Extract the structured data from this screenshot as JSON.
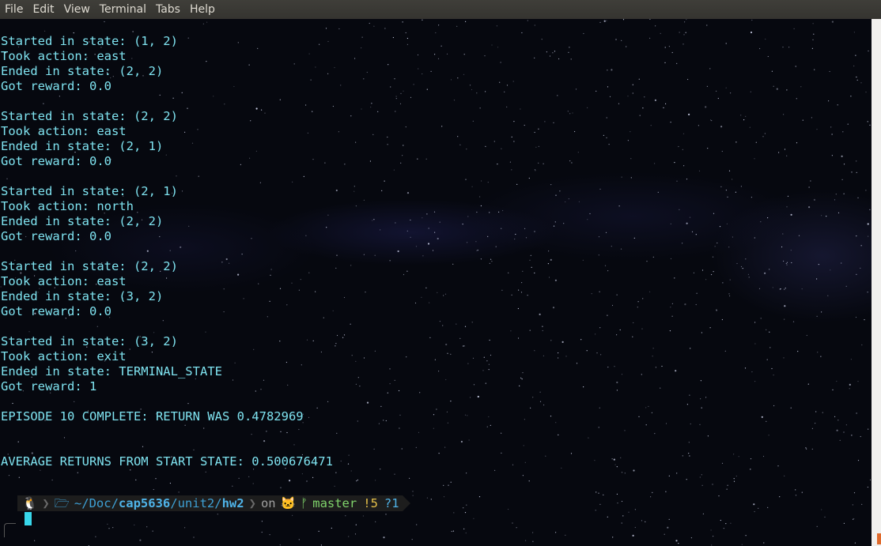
{
  "menubar": {
    "items": [
      "File",
      "Edit",
      "View",
      "Terminal",
      "Tabs",
      "Help"
    ]
  },
  "terminal": {
    "lines": [
      "Started in state: (1, 2)",
      "Took action: east",
      "Ended in state: (2, 2)",
      "Got reward: 0.0",
      "",
      "Started in state: (2, 2)",
      "Took action: east",
      "Ended in state: (2, 1)",
      "Got reward: 0.0",
      "",
      "Started in state: (2, 1)",
      "Took action: north",
      "Ended in state: (2, 2)",
      "Got reward: 0.0",
      "",
      "Started in state: (2, 2)",
      "Took action: east",
      "Ended in state: (3, 2)",
      "Got reward: 0.0",
      "",
      "Started in state: (3, 2)",
      "Took action: exit",
      "Ended in state: TERMINAL_STATE",
      "Got reward: 1",
      "",
      "EPISODE 10 COMPLETE: RETURN WAS 0.4782969",
      "",
      "",
      "AVERAGE RETURNS FROM START STATE: 0.500676471"
    ]
  },
  "prompt": {
    "os_icon": "🐧",
    "folder_icon": "🗁",
    "path_home": "~/",
    "path_seg1": "Doc",
    "path_sep1": "/",
    "path_seg2": "cap5636",
    "path_sep2": "/",
    "path_seg3": "unit2",
    "path_sep3": "/",
    "path_seg4": "hw2",
    "on_text": "on",
    "git_icon": "🐱",
    "branch_icon": "ᚠ",
    "branch": "master",
    "modified": "!5",
    "untracked": "?1"
  },
  "colors": {
    "text": "#7fe3f0",
    "menubar_bg": "#3c3b37",
    "path": "#3ea1d6",
    "branch": "#7fd36b",
    "modified": "#e6c14a",
    "cursor": "#38d7ea"
  }
}
